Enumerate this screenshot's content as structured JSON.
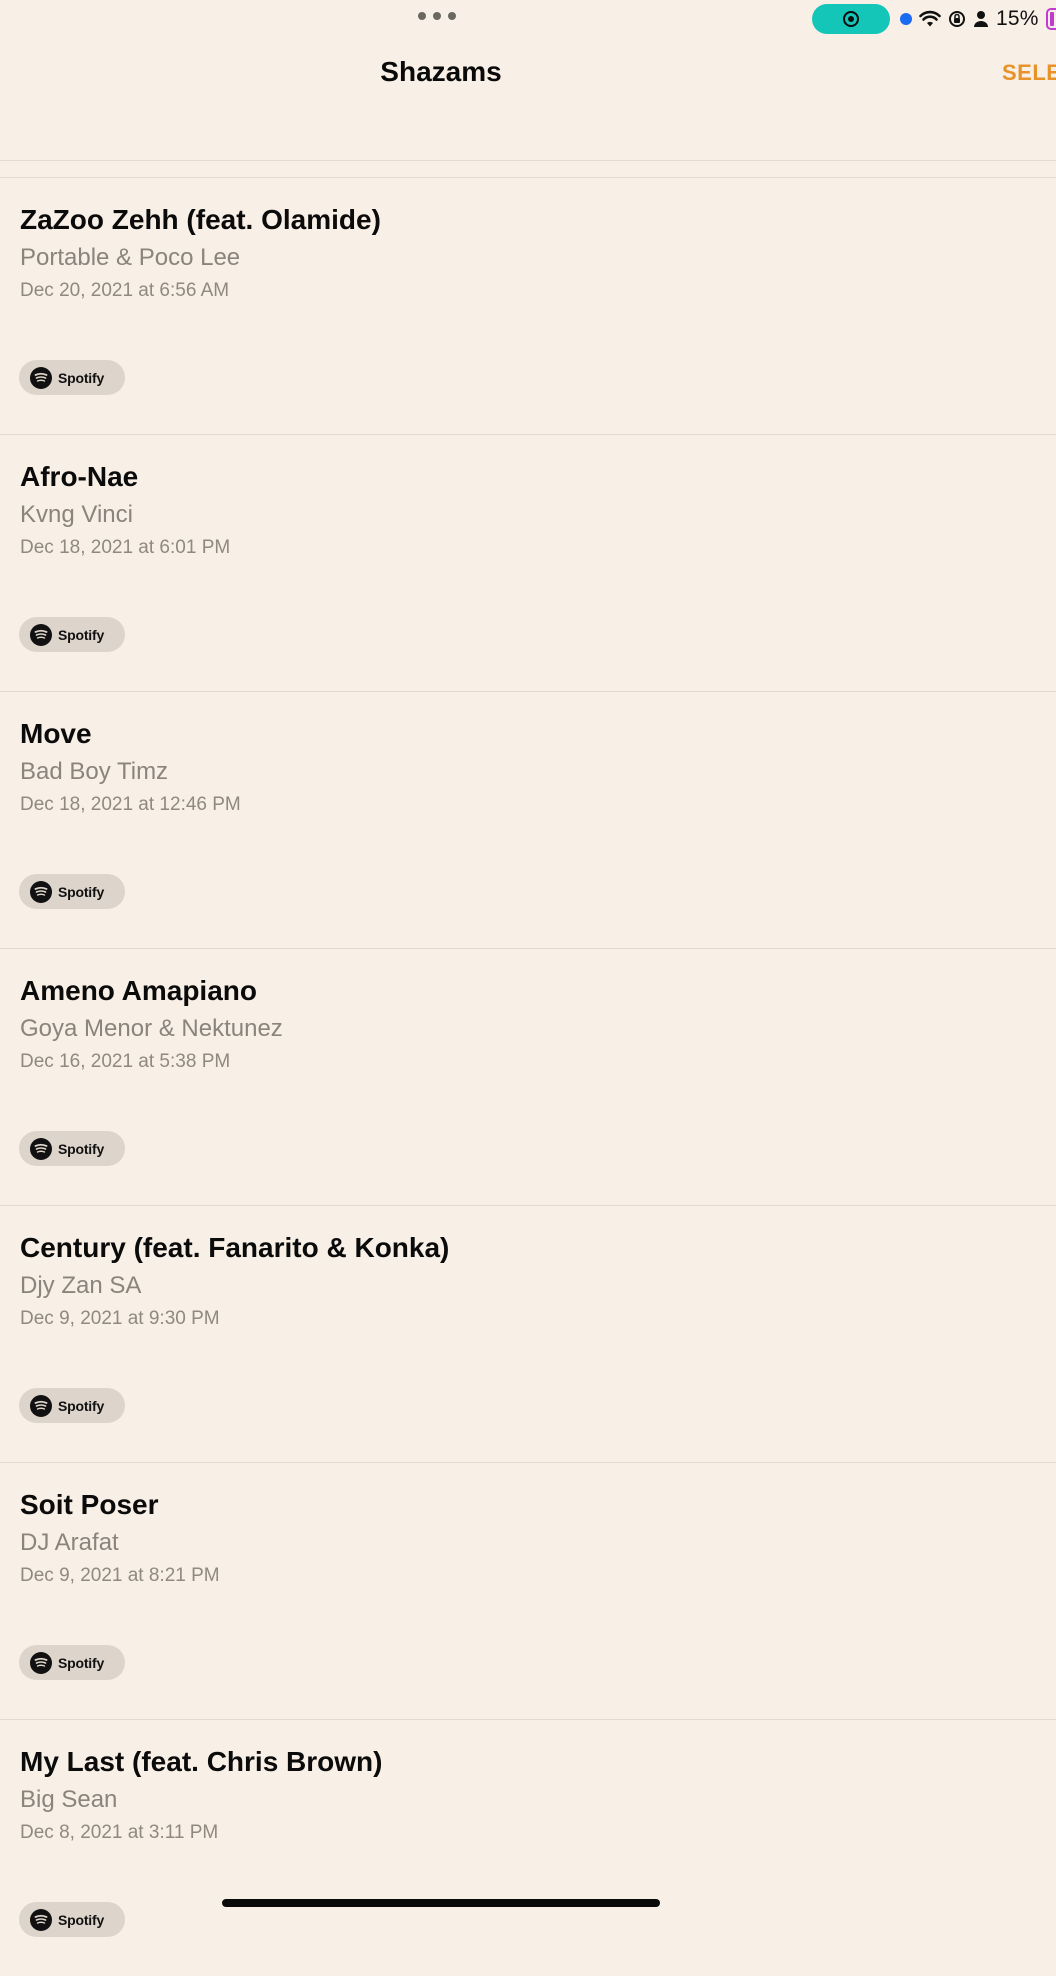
{
  "status": {
    "battery": "15%"
  },
  "nav": {
    "title": "Shazams",
    "select_label": "SELE"
  },
  "colors": {
    "background": "#f8efe6",
    "accent": "#e8932a",
    "record_pill": "#14c6b7"
  },
  "shazams": [
    {
      "title": "ZaZoo Zehh (feat. Olamide)",
      "artist": "Portable & Poco Lee",
      "date": "Dec 20, 2021 at 6:56 AM",
      "service": "Spotify"
    },
    {
      "title": "Afro-Nae",
      "artist": "Kvng Vinci",
      "date": "Dec 18, 2021 at 6:01 PM",
      "service": "Spotify"
    },
    {
      "title": "Move",
      "artist": "Bad Boy Timz",
      "date": "Dec 18, 2021 at 12:46 PM",
      "service": "Spotify"
    },
    {
      "title": "Ameno Amapiano",
      "artist": "Goya Menor & Nektunez",
      "date": "Dec 16, 2021 at 5:38 PM",
      "service": "Spotify"
    },
    {
      "title": "Century (feat. Fanarito & Konka)",
      "artist": "Djy Zan SA",
      "date": "Dec 9, 2021 at 9:30 PM",
      "service": "Spotify"
    },
    {
      "title": "Soit Poser",
      "artist": "DJ Arafat",
      "date": "Dec 9, 2021 at 8:21 PM",
      "service": "Spotify"
    },
    {
      "title": "My Last (feat. Chris Brown)",
      "artist": "Big Sean",
      "date": "Dec 8, 2021 at 3:11 PM",
      "service": "Spotify"
    }
  ]
}
